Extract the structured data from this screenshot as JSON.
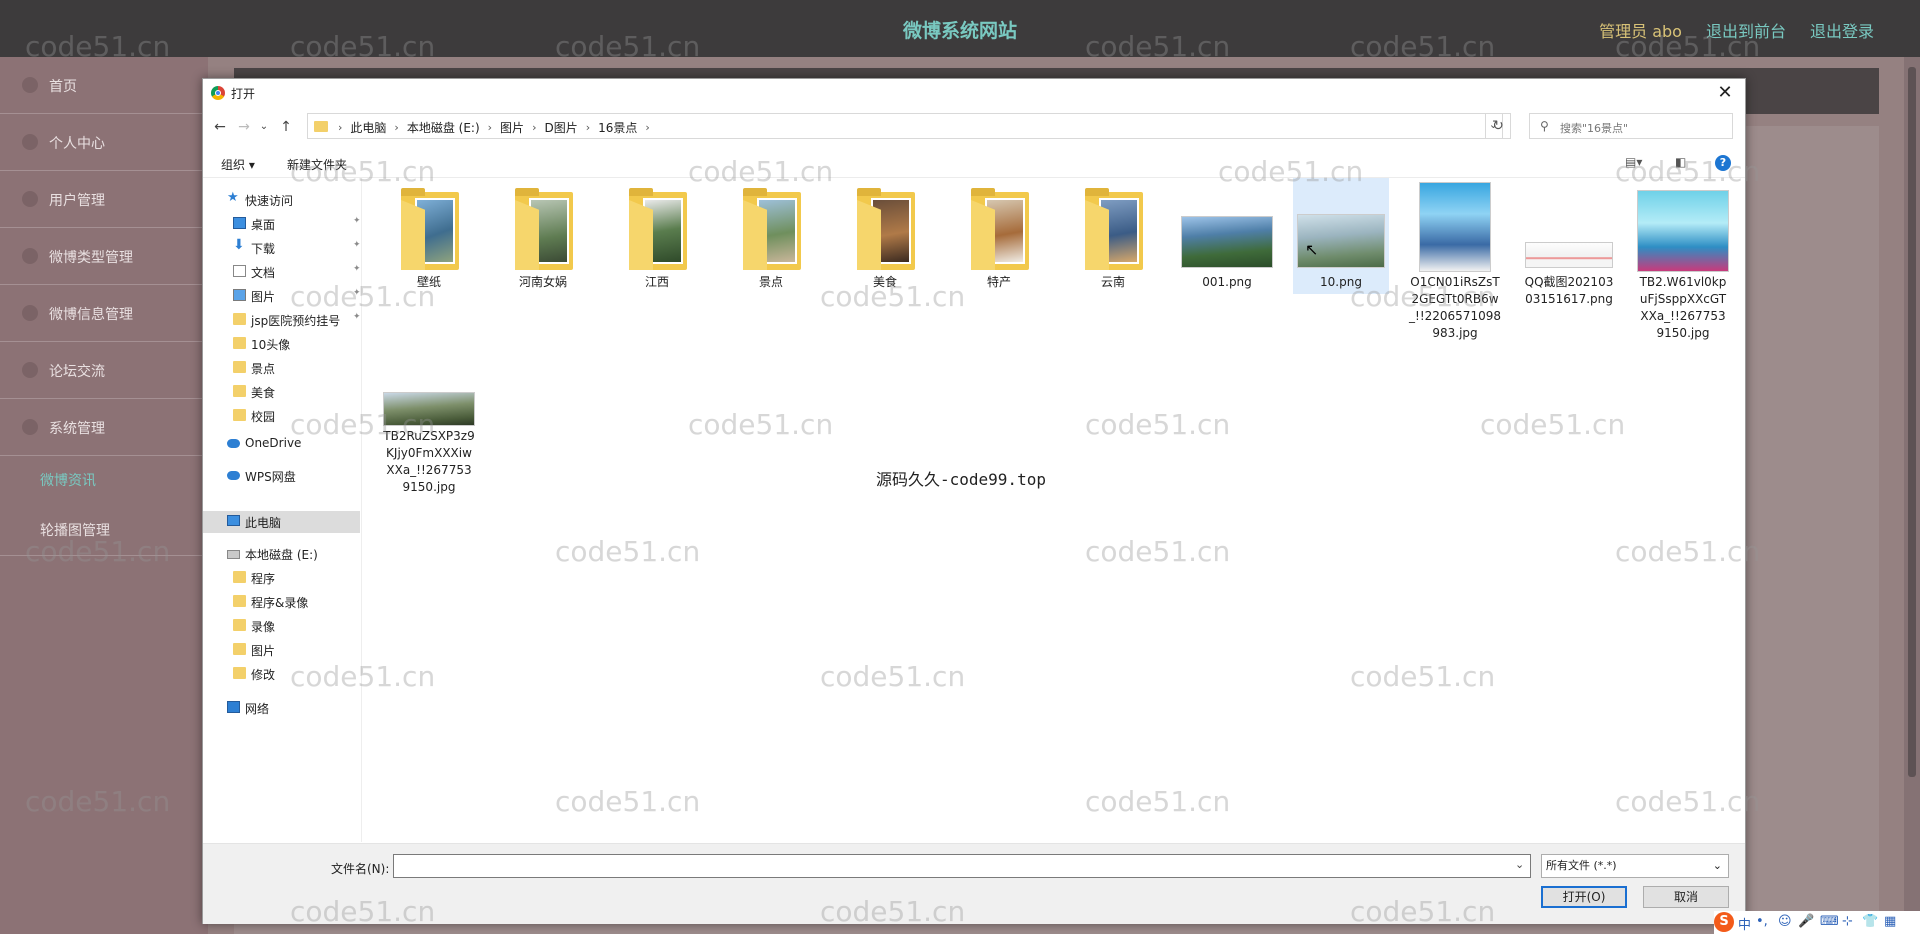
{
  "app": {
    "site_title": "微博系统网站",
    "admin_label": "管理员 abo",
    "links": [
      "退出到前台",
      "退出登录"
    ]
  },
  "sidebar": {
    "items": [
      "首页",
      "个人中心",
      "用户管理",
      "微博类型管理",
      "微博信息管理",
      "论坛交流",
      "系统管理"
    ],
    "subitems": [
      "微博资讯",
      "轮播图管理"
    ]
  },
  "watermark": "code51.cn",
  "dialog": {
    "title": "打开",
    "close": "✕",
    "breadcrumbs": [
      "此电脑",
      "本地磁盘 (E:)",
      "图片",
      "D图片",
      "16景点"
    ],
    "search_placeholder": "搜索\"16景点\"",
    "toolbar": {
      "organize": "组织 ▾",
      "new_folder": "新建文件夹",
      "help": "?"
    },
    "nav_pane": {
      "quick_access": "快速访问",
      "quick_items": [
        "桌面",
        "下载",
        "文档",
        "图片",
        "jsp医院预约挂号",
        "10头像",
        "景点",
        "美食",
        "校园"
      ],
      "onedrive": "OneDrive",
      "wps": "WPS网盘",
      "this_pc": "此电脑",
      "drive": "本地磁盘 (E:)",
      "drive_items": [
        "程序",
        "程序&录像",
        "录像",
        "图片",
        "修改"
      ],
      "network": "网络"
    },
    "folders": [
      "壁纸",
      "河南女娲",
      "江西",
      "景点",
      "美食",
      "特产",
      "云南"
    ],
    "files": [
      "001.png",
      "10.png",
      "O1CN01iRsZsT2GEGTt0RB6w_!!2206571098983.jpg",
      "QQ截图20210303151617.png",
      "TB2.W61vl0kpuFjSsppXXcGTXXa_!!2677539150.jpg",
      "TB2RuZSXP3z9KJjy0FmXXXiwXXa_!!2677539150.jpg"
    ],
    "center_note": "源码久久-code99.top",
    "filename_label": "文件名(N):",
    "filename_value": "",
    "filetype": "所有文件 (*.*)",
    "open_button": "打开(O)",
    "cancel_button": "取消"
  },
  "tray": {
    "ime": "S",
    "lang": "中"
  }
}
